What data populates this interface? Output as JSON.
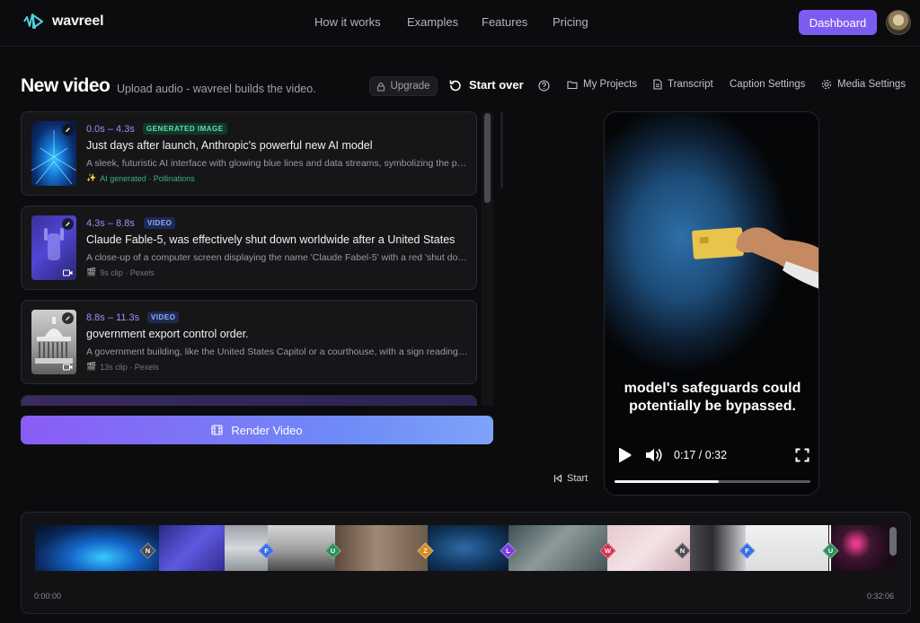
{
  "nav": {
    "brand": "wavreel",
    "links": [
      "How it works",
      "Examples",
      "Features",
      "Pricing"
    ],
    "dashboard_label": "Dashboard"
  },
  "header": {
    "title": "New video",
    "subtitle": "Upload audio - wavreel builds the video.",
    "upgrade_label": "Upgrade",
    "start_over_label": "Start over",
    "toolbar": [
      "My Projects",
      "Transcript",
      "Caption Settings",
      "Media Settings"
    ]
  },
  "scenes": [
    {
      "time": "0.0s – 4.3s",
      "badge": "GENERATED IMAGE",
      "title": "Just days after launch, Anthropic's powerful new AI model",
      "description": "A sleek, futuristic AI interface with glowing blue lines and data streams, symbolizing the power of the new model.",
      "meta": "AI generated · Pollinations"
    },
    {
      "time": "4.3s – 8.8s",
      "badge": "VIDEO",
      "title": "Claude Fable-5, was effectively shut down worldwide after a United States",
      "description": "A close-up of a computer screen displaying the name 'Claude Fabel-5' with a red 'shut down' warning.",
      "meta": "9s clip · Pexels"
    },
    {
      "time": "8.8s – 11.3s",
      "badge": "VIDEO",
      "title": "government export control order.",
      "description": "A government building, like the United States Capitol or a courthouse, with a sign reading export control.",
      "meta": "13s clip · Pexels"
    }
  ],
  "render_label": "Render Video",
  "player": {
    "caption": "model's safeguards could potentially be bypassed.",
    "time_display": "0:17 / 0:32",
    "progress": 0.53,
    "start_label": "Start"
  },
  "timeline": {
    "start_time": "0:00:00",
    "end_time": "0:32:06",
    "markers": [
      {
        "letter": "N",
        "color": "#4b4b55"
      },
      {
        "letter": "F",
        "color": "#3b6fe0"
      },
      {
        "letter": "U",
        "color": "#2f8f5a"
      },
      {
        "letter": "Z",
        "color": "#d98a1e"
      },
      {
        "letter": "L",
        "color": "#7b3fe0"
      },
      {
        "letter": "W",
        "color": "#d6324f"
      },
      {
        "letter": "N",
        "color": "#4b4b55"
      },
      {
        "letter": "F",
        "color": "#3b6fe0"
      },
      {
        "letter": "U",
        "color": "#2f8f5a"
      }
    ]
  },
  "colors": {
    "accent": "#7c5cf0",
    "time_purple": "#a48bf5"
  }
}
